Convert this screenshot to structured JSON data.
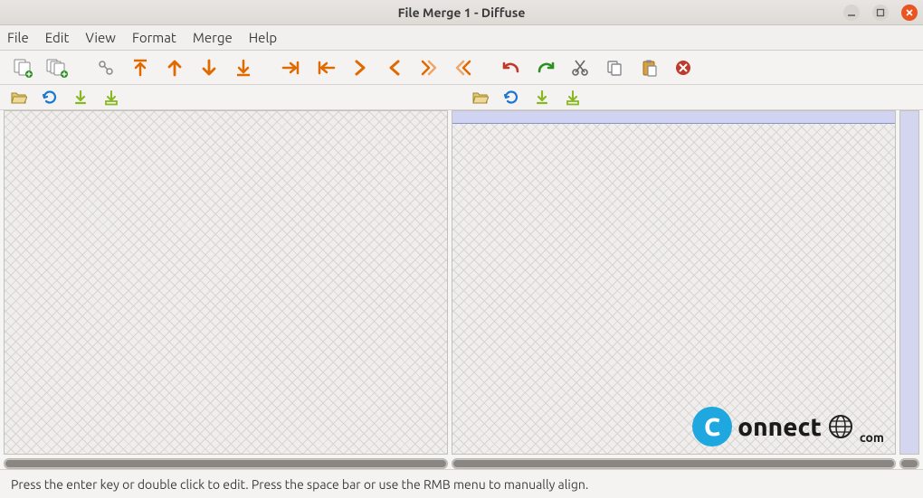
{
  "title": "File Merge 1 - Diffuse",
  "menus": {
    "file": "File",
    "edit": "Edit",
    "view": "View",
    "format": "Format",
    "merge": "Merge",
    "help": "Help"
  },
  "toolbar": {
    "new_2way": "new-2way",
    "new_3way": "new-3way",
    "realign": "realign",
    "first_diff": "first-diff",
    "prev_diff": "prev-diff",
    "next_diff": "next-diff",
    "last_diff": "last-diff",
    "push_right": "push-right",
    "push_left": "push-left",
    "copy_right": "copy-right",
    "copy_left": "copy-left",
    "merge_right": "merge-from-right",
    "merge_left": "merge-from-left",
    "undo": "undo",
    "redo": "redo",
    "cut": "cut",
    "copy": "copy",
    "paste": "paste",
    "clear": "clear"
  },
  "file_toolbar": {
    "open": "open",
    "reload": "reload",
    "save": "save",
    "save_as": "save-as"
  },
  "status": "Press the enter key or double click to edit.  Press the space bar or use the RMB menu to manually align.",
  "watermark": {
    "brand": "onnect",
    "suffix": "com"
  }
}
